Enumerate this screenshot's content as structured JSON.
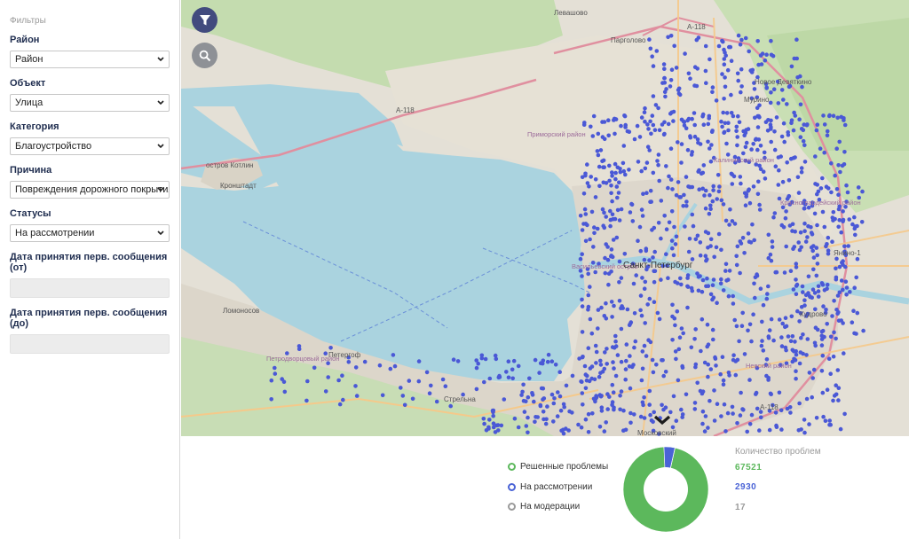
{
  "sidebar": {
    "title": "Фильтры",
    "filters": [
      {
        "label": "Район",
        "value": "Район"
      },
      {
        "label": "Объект",
        "value": "Улица"
      },
      {
        "label": "Категория",
        "value": "Благоустройство"
      },
      {
        "label": "Причина",
        "value": "Повреждения дорожного покрытия"
      },
      {
        "label": "Статусы",
        "value": "На рассмотрении"
      }
    ],
    "date_from_label": "Дата принятия перв. сообщения (от)",
    "date_from_value": "",
    "date_to_label": "Дата принятия перв. сообщения (до)",
    "date_to_value": ""
  },
  "map": {
    "buttons": {
      "filter": "filter-icon",
      "search": "search-icon"
    },
    "labels": {
      "city": "Санкт-Петербург",
      "kronstadt": "Кронштадт",
      "peterhof": "Петергоф",
      "lomonosov": "Ломоносов",
      "strelna": "Стрельна",
      "pargolovo": "Парголово",
      "levashovo": "Левашово",
      "murino": "Мурино",
      "novoe_devyatkino": "Новое Девяткино",
      "kudrovo": "Кудрово",
      "yanino": "Янино-1",
      "kotlin": "остров Котлин",
      "vasilievsky": "Васильевский остров",
      "moskovsky": "Московский",
      "primorsky": "Приморский район",
      "kalininsky": "Калининский район",
      "nevsky": "Невский район",
      "krasnogvardeisky": "Красногвардейский район",
      "petrodvortsovy": "Петродворцовый район",
      "road_a118_west": "А-118",
      "road_a118_north": "А-118",
      "road_a118_south": "А-118"
    },
    "collapse_icon": "chevron-down-icon"
  },
  "stats": {
    "count_header": "Количество проблем",
    "rows": [
      {
        "label": "Решенные проблемы",
        "value": "67521",
        "color": "#5cb85c"
      },
      {
        "label": "На рассмотрении",
        "value": "2930",
        "color": "#4a63d6"
      },
      {
        "label": "На модерации",
        "value": "17",
        "color": "#9a9a9a"
      }
    ],
    "donut": {
      "solved": 67521,
      "review": 2930,
      "moderation": 17
    }
  },
  "colors": {
    "filter_button": "#424b7e",
    "search_button": "#8e9196",
    "label_text": "#1f2d4f",
    "water": "#aad3df",
    "point": "#4a58d6"
  }
}
